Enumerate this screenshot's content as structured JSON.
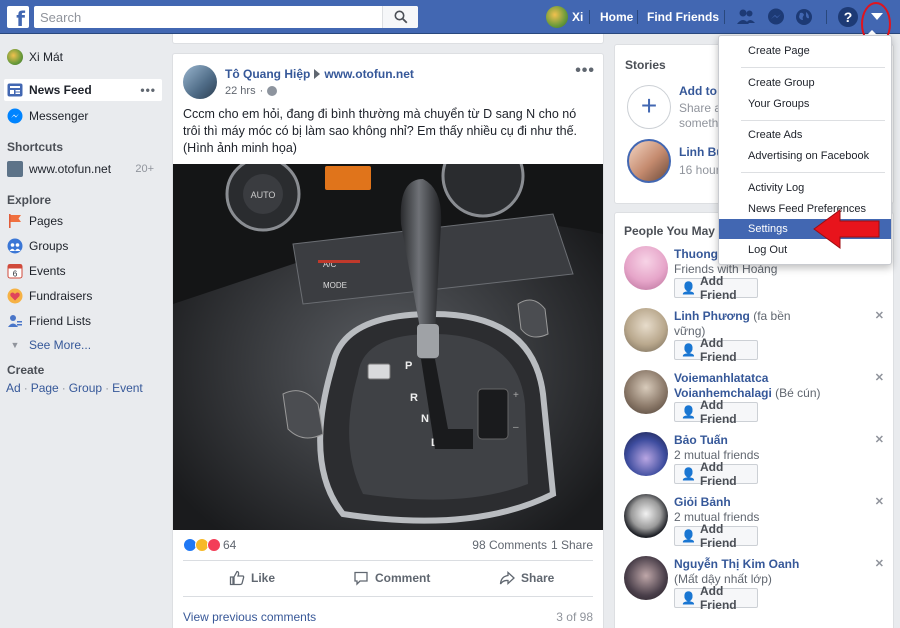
{
  "topbar": {
    "logo": "f",
    "search_placeholder": "Search",
    "user_name": "Xi",
    "home": "Home",
    "find_friends": "Find Friends",
    "help": "?"
  },
  "sidebar": {
    "profile": "Xi Mát",
    "news_feed": "News Feed",
    "messenger": "Messenger",
    "shortcuts_title": "Shortcuts",
    "shortcut": {
      "label": "www.otofun.net",
      "count": "20+"
    },
    "explore_title": "Explore",
    "explore": [
      "Pages",
      "Groups",
      "Events",
      "Fundraisers",
      "Friend Lists"
    ],
    "see_more": "See More...",
    "create_title": "Create",
    "create_links": [
      "Ad",
      "Page",
      "Group",
      "Event"
    ]
  },
  "post": {
    "author": "Tô Quang Hiệp",
    "target": "www.otofun.net",
    "time": "22 hrs",
    "text": "Cccm cho em hỏi, đang đi bình thường mà chuyển từ D sang N cho nó trôi thì máy móc có bị làm sao không nhỉ? Em thấy nhiều cụ đi như thế.",
    "text2": "(Hình ảnh minh họa)",
    "image_labels": {
      "auto": "AUTO",
      "mode": "MODE",
      "ac": "A/C",
      "p": "P",
      "r": "R",
      "n": "N",
      "d": "D",
      "plus": "+",
      "minus": "–"
    },
    "reaction_count": "64",
    "comments": "98 Comments",
    "shares": "1 Share",
    "like": "Like",
    "comment": "Comment",
    "share": "Share",
    "view_previous": "View previous comments",
    "page": "3 of 98"
  },
  "stories": {
    "title": "Stories",
    "add_title": "Add to Y",
    "add_sub1": "Share a",
    "add_sub2": "somethi",
    "story_name": "Linh Bù",
    "story_time": "16 hours"
  },
  "pymk": {
    "title": "People You May K",
    "add_friend": "Add Friend",
    "people": [
      {
        "name": "Thuong",
        "nick": "",
        "name2": "",
        "sub": "Friends with Hoàng",
        "avatar": "#e6a5c9"
      },
      {
        "name": "Linh Phương",
        "nick": "(fa bền",
        "name2": "",
        "sub": "vững)",
        "avatar": "#b9a88d"
      },
      {
        "name": "Voiemanhlatatca",
        "nick": "(Bé cún)",
        "name2": "Voianhemchalagi",
        "sub": "",
        "avatar": "#8c7a6a"
      },
      {
        "name": "Bảo Tuấn",
        "nick": "",
        "name2": "",
        "sub": "2 mutual friends",
        "avatar": "#3d4c9e"
      },
      {
        "name": "Giỏi Bảnh",
        "nick": "",
        "name2": "",
        "sub": "2 mutual friends",
        "avatar": "#202228"
      },
      {
        "name": "Nguyễn Thị Kim Oanh",
        "nick": "",
        "name2": "",
        "sub": "(Mất dậy nhất lớp)",
        "avatar": "#4a3f4a"
      }
    ]
  },
  "dropdown": {
    "items": [
      "Create Page",
      "Create Group",
      "Your Groups",
      "Create Ads",
      "Advertising on Facebook",
      "Activity Log",
      "News Feed Preferences",
      "Settings",
      "Log Out"
    ],
    "highlighted": "Settings"
  },
  "colors": {
    "brand": "#4267b2",
    "link": "#365899",
    "highlight_ring": "#e0141e",
    "arrow": "#e8141c"
  }
}
